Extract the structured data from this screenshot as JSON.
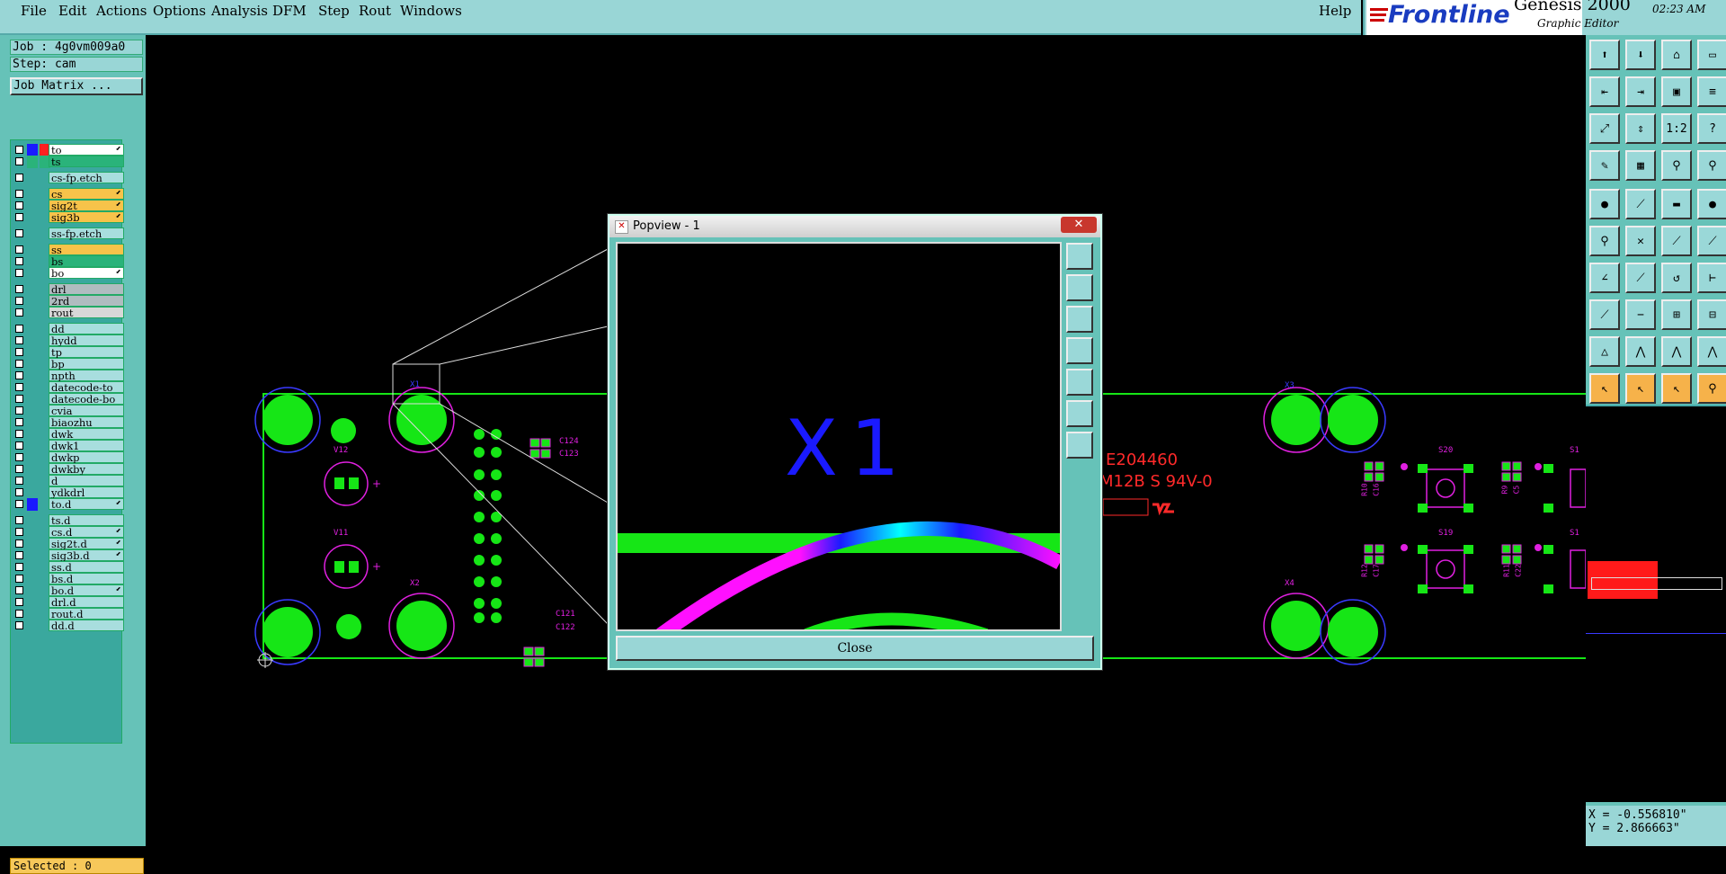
{
  "menu": [
    {
      "label": "File"
    },
    {
      "label": "Edit"
    },
    {
      "label": "Actions"
    },
    {
      "label": "Options"
    },
    {
      "label": "Analysis"
    },
    {
      "label": "DFM"
    },
    {
      "label": "Step"
    },
    {
      "label": "Rout"
    },
    {
      "label": "Windows"
    }
  ],
  "help_label": "Help",
  "brand": {
    "logo": "Frontline",
    "product": "Genesis 2000",
    "subtitle": "Graphic Editor",
    "time": "02:23 AM"
  },
  "job": {
    "job_line": "Job : 4g0vm009a0",
    "step_line": "Step: cam",
    "matrix_button": "Job Matrix ..."
  },
  "layers": [
    {
      "name": "to",
      "color": "#ffffff",
      "sw1": "#1a1aff",
      "sw2": "#ff2020",
      "affected": true
    },
    {
      "name": "ts",
      "color": "#2ab37a",
      "sw1": "#2ab37a",
      "sw2": "#2ab37a"
    },
    {
      "name": "cs-fp.etch",
      "color": "#a8dede"
    },
    {
      "name": "cs",
      "color": "#f7c34a",
      "affected": true
    },
    {
      "name": "sig2t",
      "color": "#f7c34a",
      "affected": true
    },
    {
      "name": "sig3b",
      "color": "#f7c34a",
      "affected": true
    },
    {
      "name": "ss-fp.etch",
      "color": "#a8dede"
    },
    {
      "name": "ss",
      "color": "#f7c34a"
    },
    {
      "name": "bs",
      "color": "#2ab37a"
    },
    {
      "name": "bo",
      "color": "#ffffff",
      "affected": true
    },
    {
      "name": "drl",
      "color": "#b0bcc0"
    },
    {
      "name": "2rd",
      "color": "#b0bcc0"
    },
    {
      "name": "rout",
      "color": "#d8d8d8"
    },
    {
      "name": "dd",
      "color": "#a8dede"
    },
    {
      "name": "hydd",
      "color": "#a8dede"
    },
    {
      "name": "tp",
      "color": "#a8dede"
    },
    {
      "name": "bp",
      "color": "#a8dede"
    },
    {
      "name": "npth",
      "color": "#a8dede"
    },
    {
      "name": "datecode-to",
      "color": "#a8dede"
    },
    {
      "name": "datecode-bo",
      "color": "#a8dede"
    },
    {
      "name": "cvia",
      "color": "#a8dede"
    },
    {
      "name": "biaozhu",
      "color": "#a8dede"
    },
    {
      "name": "dwk",
      "color": "#a8dede"
    },
    {
      "name": "dwk1",
      "color": "#a8dede"
    },
    {
      "name": "dwkp",
      "color": "#a8dede"
    },
    {
      "name": "dwkby",
      "color": "#a8dede"
    },
    {
      "name": "d",
      "color": "#a8dede"
    },
    {
      "name": "ydkdrl",
      "color": "#a8dede"
    },
    {
      "name": "to.d",
      "color": "#a8dede",
      "sw1": "#1a1aff",
      "affected": true
    },
    {
      "name": "ts.d",
      "color": "#a8dede"
    },
    {
      "name": "cs.d",
      "color": "#a8dede",
      "affected": true
    },
    {
      "name": "sig2t.d",
      "color": "#a8dede",
      "affected": true
    },
    {
      "name": "sig3b.d",
      "color": "#a8dede",
      "affected": true
    },
    {
      "name": "ss.d",
      "color": "#a8dede"
    },
    {
      "name": "bs.d",
      "color": "#a8dede"
    },
    {
      "name": "bo.d",
      "color": "#a8dede",
      "affected": true
    },
    {
      "name": "drl.d",
      "color": "#a8dede"
    },
    {
      "name": "rout.d",
      "color": "#a8dede"
    },
    {
      "name": "dd.d",
      "color": "#a8dede"
    }
  ],
  "selected": "Selected : 0",
  "coords": {
    "x": "X = -0.556810\"",
    "y": "Y = 2.866663\""
  },
  "popview": {
    "title": "Popview - 1",
    "close_label": "Close",
    "zoom_text": "X1"
  },
  "board": {
    "labels": [
      "V12",
      "V11",
      "X1",
      "X2",
      "X3",
      "X4",
      "C124",
      "C123",
      "C121",
      "C122",
      "S20",
      "S19",
      "S1",
      "S1"
    ],
    "marking_1": "E204460",
    "marking_2": "M12B  S 94V-0",
    "small_labels": [
      "R10",
      "C16",
      "R9",
      "C5",
      "R12",
      "C17",
      "R11",
      "C22"
    ]
  },
  "colors": {
    "pad": "#16e616",
    "outline": "#e020e0",
    "blue": "#1a1aff",
    "marking": "#ff2a2a",
    "teal": "#66c2b8"
  }
}
